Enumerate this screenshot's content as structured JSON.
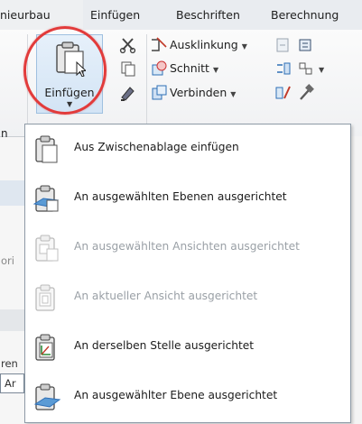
{
  "ribbon_tabs": [
    "nieurbau",
    "Einfügen",
    "Beschriften",
    "Berechnung"
  ],
  "paste_button": {
    "label": "Einfügen",
    "icon": "clipboard-paste-icon"
  },
  "tools": {
    "ausklinkung": "Ausklinkung",
    "schnitt": "Schnitt",
    "verbinden": "Verbinden"
  },
  "left_stubs": {
    "group": "n",
    "row1": "ori",
    "row2": "ren",
    "row3": "Ar"
  },
  "menu_items": [
    {
      "label": "Aus Zwischenablage einfügen",
      "icon": "clipboard-icon",
      "enabled": true
    },
    {
      "label": "An ausgewählten Ebenen ausgerichtet",
      "icon": "paste-aligned-levels-icon",
      "enabled": true
    },
    {
      "label": "An ausgewählten Ansichten ausgerichtet",
      "icon": "paste-aligned-views-icon",
      "enabled": false
    },
    {
      "label": "An aktueller Ansicht ausgerichtet",
      "icon": "paste-current-view-icon",
      "enabled": false
    },
    {
      "label": "An derselben Stelle ausgerichtet",
      "icon": "paste-same-place-icon",
      "enabled": true
    },
    {
      "label": "An ausgewählter Ebene ausgerichtet",
      "icon": "paste-selected-level-icon",
      "enabled": true
    }
  ],
  "colors": {
    "highlight_ring": "#e23b3b",
    "selected_button": "#d3e4f5",
    "disabled_text": "#9aa0a6"
  }
}
